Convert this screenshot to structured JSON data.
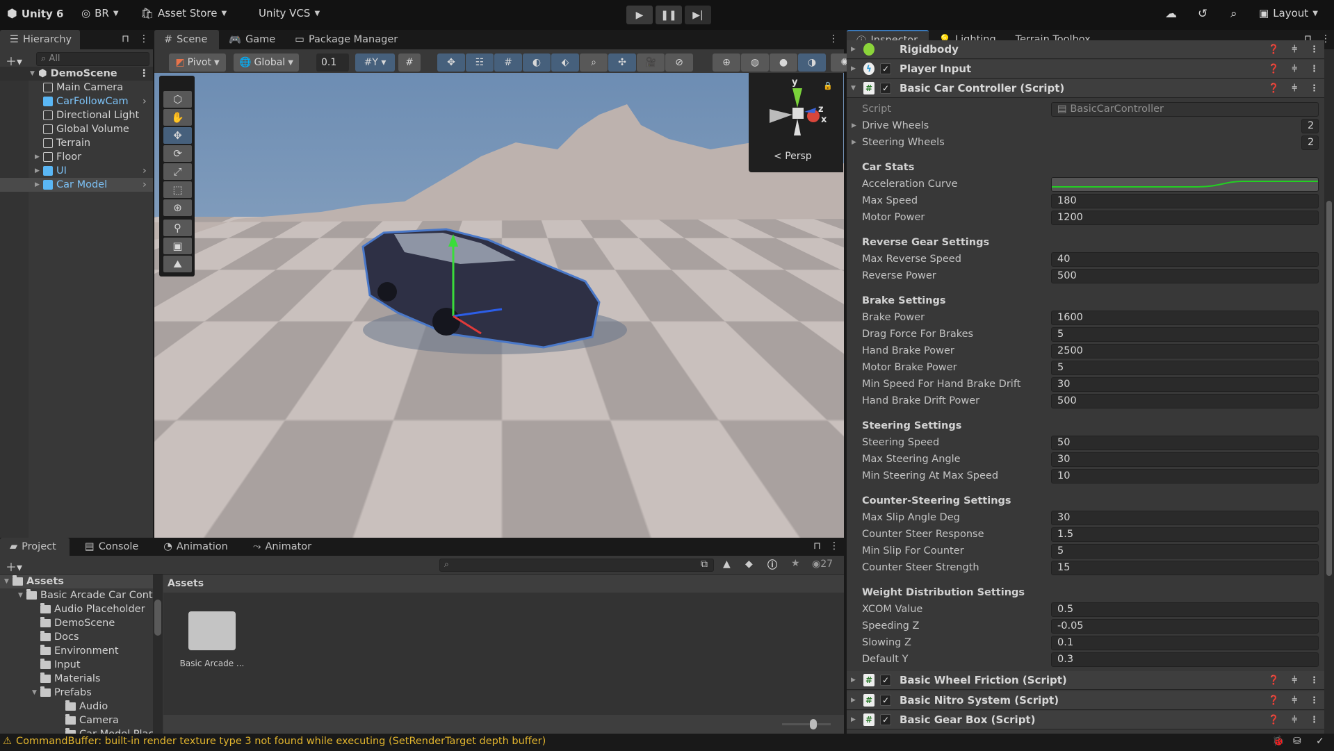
{
  "topbar": {
    "app_title": "Unity 6",
    "account": "BR",
    "asset_store": "Asset Store",
    "vcs": "Unity VCS",
    "layout": "Layout",
    "play_icons": [
      "play-icon",
      "pause-icon",
      "step-icon"
    ]
  },
  "hierarchy": {
    "tab": "Hierarchy",
    "search_placeholder": "All",
    "scene": "DemoScene",
    "items": [
      {
        "label": "Main Camera",
        "depth": 1,
        "prefab": false,
        "expandable": false
      },
      {
        "label": "CarFollowCam",
        "depth": 1,
        "prefab": true,
        "expandable": false
      },
      {
        "label": "Directional Light",
        "depth": 1,
        "prefab": false,
        "expandable": false
      },
      {
        "label": "Global Volume",
        "depth": 1,
        "prefab": false,
        "expandable": false
      },
      {
        "label": "Terrain",
        "depth": 1,
        "prefab": false,
        "expandable": false
      },
      {
        "label": "Floor",
        "depth": 1,
        "prefab": false,
        "expandable": true
      },
      {
        "label": "UI",
        "depth": 1,
        "prefab": true,
        "expandable": true
      },
      {
        "label": "Car Model",
        "depth": 1,
        "prefab": true,
        "expandable": true,
        "selected": true
      }
    ]
  },
  "scene_tabs": {
    "scene": "Scene",
    "game": "Game",
    "package_manager": "Package Manager"
  },
  "scene_toolbar": {
    "pivot": "Pivot",
    "global": "Global",
    "snap_value": "0.1"
  },
  "gizmo": {
    "y": "y",
    "z": "z",
    "x": "x",
    "projection": "Persp"
  },
  "inspector": {
    "tabs": {
      "inspector": "Inspector",
      "lighting": "Lighting",
      "terrain": "Terrain Toolbox"
    },
    "components_top": [
      {
        "name": "Rigidbody"
      },
      {
        "name": "Player Input",
        "enabled": true
      },
      {
        "name": "Basic Car Controller (Script)",
        "enabled": true
      }
    ],
    "script_label": "Script",
    "script_value": "BasicCarController",
    "drive_wheels": {
      "label": "Drive Wheels",
      "count": "2"
    },
    "steering_wheels": {
      "label": "Steering Wheels",
      "count": "2"
    },
    "sections": [
      {
        "title": "Car Stats",
        "rows": [
          {
            "label": "Acceleration Curve",
            "curve": true
          },
          {
            "label": "Max Speed",
            "value": "180"
          },
          {
            "label": "Motor Power",
            "value": "1200"
          }
        ]
      },
      {
        "title": "Reverse Gear Settings",
        "rows": [
          {
            "label": "Max Reverse Speed",
            "value": "40"
          },
          {
            "label": "Reverse Power",
            "value": "500"
          }
        ]
      },
      {
        "title": "Brake Settings",
        "rows": [
          {
            "label": "Brake Power",
            "value": "1600"
          },
          {
            "label": "Drag Force For Brakes",
            "value": "5"
          },
          {
            "label": "Hand Brake Power",
            "value": "2500"
          },
          {
            "label": "Motor Brake Power",
            "value": "5"
          },
          {
            "label": "Min Speed For Hand Brake Drift",
            "value": "30"
          },
          {
            "label": "Hand Brake Drift Power",
            "value": "500"
          }
        ]
      },
      {
        "title": "Steering Settings",
        "rows": [
          {
            "label": "Steering Speed",
            "value": "50"
          },
          {
            "label": "Max Steering Angle",
            "value": "30"
          },
          {
            "label": "Min Steering At Max Speed",
            "value": "10"
          }
        ]
      },
      {
        "title": "Counter-Steering Settings",
        "rows": [
          {
            "label": "Max Slip Angle Deg",
            "value": "30"
          },
          {
            "label": "Counter Steer Response",
            "value": "1.5"
          },
          {
            "label": "Min Slip For Counter",
            "value": "5"
          },
          {
            "label": "Counter Steer Strength",
            "value": "15"
          }
        ]
      },
      {
        "title": "Weight Distribution Settings",
        "rows": [
          {
            "label": "XCOM Value",
            "value": "0.5"
          },
          {
            "label": "Speeding Z",
            "value": "-0.05"
          },
          {
            "label": "Slowing Z",
            "value": "0.1"
          },
          {
            "label": "Default Y",
            "value": "0.3"
          }
        ]
      }
    ],
    "components_bottom": [
      {
        "name": "Basic Wheel Friction (Script)",
        "enabled": true
      },
      {
        "name": "Basic Nitro System (Script)",
        "enabled": true
      },
      {
        "name": "Basic Gear Box (Script)",
        "enabled": true
      }
    ]
  },
  "bottom_tabs": {
    "project": "Project",
    "console": "Console",
    "animation": "Animation",
    "animator": "Animator"
  },
  "project": {
    "hidden_count": "27",
    "breadcrumb": "Assets",
    "tree": [
      {
        "label": "Assets",
        "depth": 0,
        "open": true
      },
      {
        "label": "Basic Arcade Car Cont",
        "depth": 1,
        "open": true
      },
      {
        "label": "Audio Placeholder",
        "depth": 2
      },
      {
        "label": "DemoScene",
        "depth": 2
      },
      {
        "label": "Docs",
        "depth": 2
      },
      {
        "label": "Environment",
        "depth": 2
      },
      {
        "label": "Input",
        "depth": 2
      },
      {
        "label": "Materials",
        "depth": 2
      },
      {
        "label": "Prefabs",
        "depth": 2,
        "open": true
      },
      {
        "label": "Audio",
        "depth": 3
      },
      {
        "label": "Camera",
        "depth": 3
      },
      {
        "label": "Car Model Placeh",
        "depth": 3
      }
    ],
    "grid_items": [
      {
        "label": "Basic Arcade ..."
      }
    ]
  },
  "status": {
    "message": "CommandBuffer: built-in render texture type 3 not found while executing  (SetRenderTarget depth buffer)",
    "color": "#e2b52e"
  }
}
